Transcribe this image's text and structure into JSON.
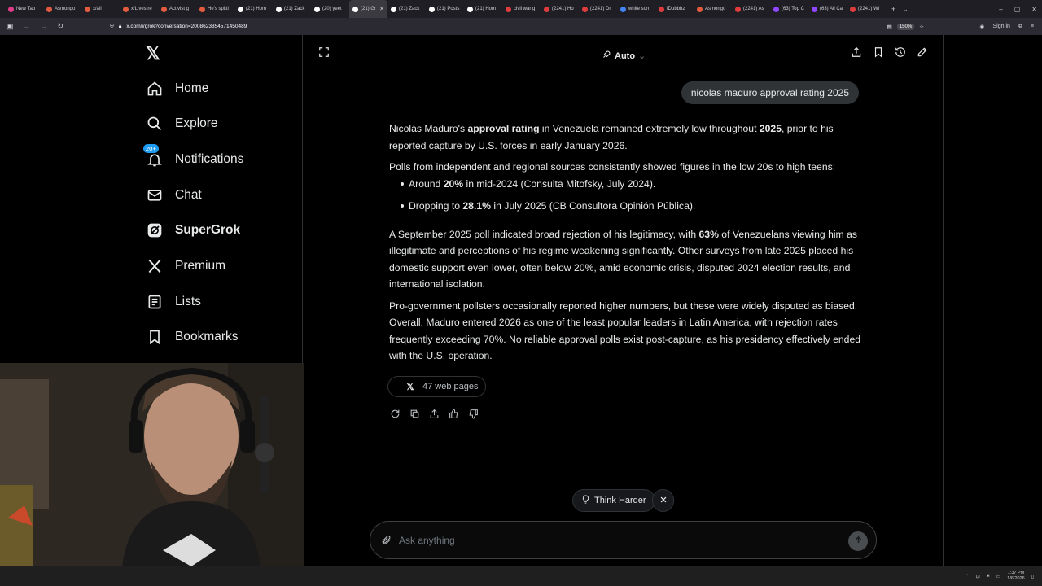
{
  "browser": {
    "tabs": [
      {
        "label": "New Tab",
        "color": "#e03c8a"
      },
      {
        "label": "Asmongo",
        "color": "#e35b3f"
      },
      {
        "label": "x/all",
        "color": "#e35b3f"
      },
      {
        "label": "x/Livestre",
        "color": "#e35b3f"
      },
      {
        "label": "Activist g",
        "color": "#e35b3f"
      },
      {
        "label": "He's spitti",
        "color": "#e35b3f"
      },
      {
        "label": "(21) Hom",
        "color": "#ffffff"
      },
      {
        "label": "(21) Zack",
        "color": "#ffffff"
      },
      {
        "label": "(20) yeet",
        "color": "#ffffff"
      },
      {
        "label": "(21) Gr",
        "color": "#ffffff",
        "active": true
      },
      {
        "label": "(21) Zack",
        "color": "#ffffff"
      },
      {
        "label": "(21) Posts",
        "color": "#ffffff"
      },
      {
        "label": "(21) Hom",
        "color": "#ffffff"
      },
      {
        "label": "civil war g",
        "color": "#e03c3c"
      },
      {
        "label": "(2241) Ho",
        "color": "#e03c3c"
      },
      {
        "label": "(2241) Dr",
        "color": "#e03c3c"
      },
      {
        "label": "white son",
        "color": "#4285f4"
      },
      {
        "label": "IDubbbz",
        "color": "#e03c3c"
      },
      {
        "label": "Asmongo",
        "color": "#e35b3f"
      },
      {
        "label": "(2241) As",
        "color": "#e03c3c"
      },
      {
        "label": "(63) Top C",
        "color": "#9146ff"
      },
      {
        "label": "(63) All Ca",
        "color": "#9146ff"
      },
      {
        "label": "(2241) Wi",
        "color": "#e03c3c"
      }
    ],
    "new_tab_glyph": "+",
    "tab_list_glyph": "⌄",
    "url": "x.com/i/grok?conversation=2008623854571450489",
    "zoom": "150%",
    "sign_in": "Sign in",
    "window_controls": [
      "–",
      "▢",
      "✕"
    ]
  },
  "sidebar": {
    "logo": "𝕏",
    "items": [
      {
        "label": "Home",
        "icon": "home-icon"
      },
      {
        "label": "Explore",
        "icon": "search-icon"
      },
      {
        "label": "Notifications",
        "icon": "bell-icon",
        "badge": "20+"
      },
      {
        "label": "Chat",
        "icon": "mail-icon"
      },
      {
        "label": "SuperGrok",
        "icon": "grok-icon",
        "bold": true
      },
      {
        "label": "Premium",
        "icon": "x-premium-icon"
      },
      {
        "label": "Lists",
        "icon": "list-icon"
      },
      {
        "label": "Bookmarks",
        "icon": "bookmark-icon"
      }
    ]
  },
  "header": {
    "mode_label": "Auto",
    "mode_chevron": "⌄"
  },
  "conversation": {
    "user_message": "nicolas maduro approval rating 2025",
    "answer": {
      "p1_a": "Nicolás Maduro's ",
      "p1_b": "approval rating",
      "p1_c": " in Venezuela remained extremely low throughout ",
      "p1_d": "2025",
      "p1_e": ", prior to his reported capture by U.S. forces in early January 2026.",
      "p2": "Polls from independent and regional sources consistently showed figures in the low 20s to high teens:",
      "b1_a": "Around ",
      "b1_b": "20%",
      "b1_c": " in mid-2024 (Consulta Mitofsky, July 2024).",
      "b2_a": "Dropping to ",
      "b2_b": "28.1%",
      "b2_c": " in July 2025 (CB Consultora Opinión Pública).",
      "p3_a": "A September 2025 poll indicated broad rejection of his legitimacy, with ",
      "p3_b": "63%",
      "p3_c": " of Venezuelans viewing him as illegitimate and perceptions of his regime weakening significantly. Other surveys from late 2025 placed his domestic support even lower, often below 20%, amid economic crisis, disputed 2024 election results, and international isolation.",
      "p4": "Pro-government pollsters occasionally reported higher numbers, but these were widely disputed as biased. Overall, Maduro entered 2026 as one of the least popular leaders in Latin America, with rejection rates frequently exceeding 70%. No reliable approval polls exist post-capture, as his presidency effectively ended with the U.S. operation."
    },
    "sources_label": "47 web pages"
  },
  "chips": {
    "think_harder": "Think Harder"
  },
  "composer": {
    "placeholder": "Ask anything",
    "value": ""
  },
  "taskbar": {
    "time": "1:37 PM",
    "date": "1/6/2026"
  },
  "colors": {
    "accent": "#1d9bf0",
    "background": "#000000",
    "text": "#e7e9ea",
    "border": "#2f3336"
  }
}
